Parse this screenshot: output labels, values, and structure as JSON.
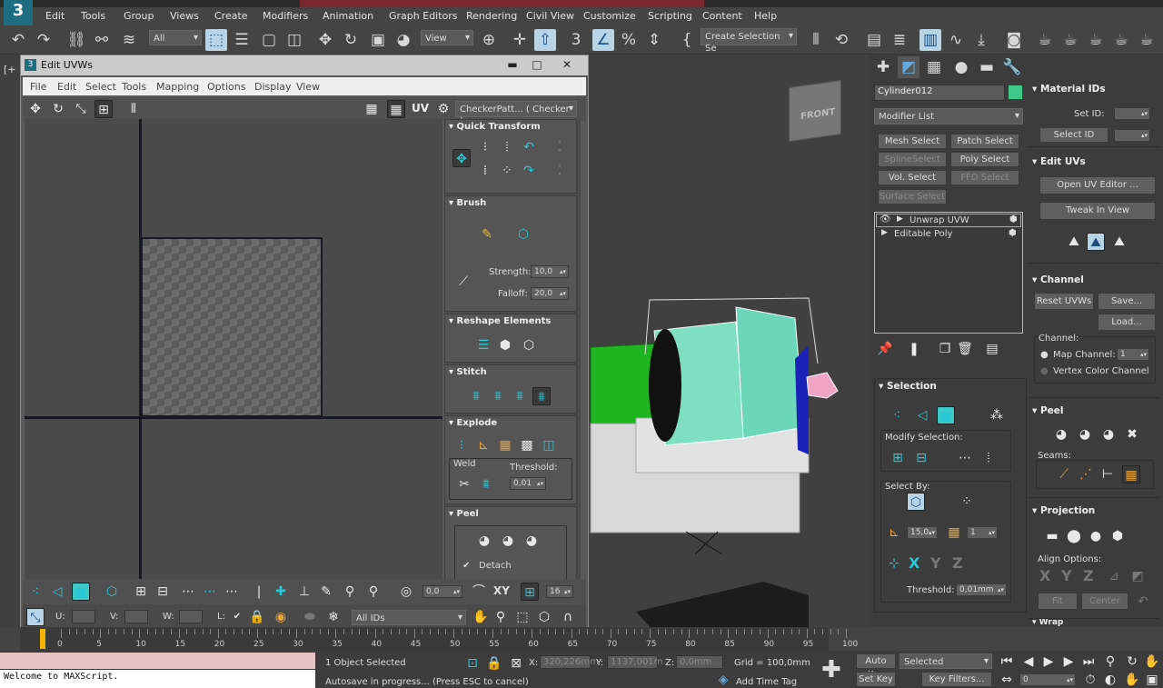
{
  "menus": [
    "Edit",
    "Tools",
    "Group",
    "Views",
    "Create",
    "Modifiers",
    "Animation",
    "Graph Editors",
    "Rendering",
    "Civil View",
    "Customize",
    "Scripting",
    "Content",
    "Help"
  ],
  "toolbar": {
    "filter": "All",
    "view": "View",
    "create_selection": "Create Selection Se"
  },
  "viewport": {
    "label": "[+",
    "viewcube": "FRONT"
  },
  "uv_window": {
    "title": "Edit UVWs",
    "title_icon": "3",
    "menu": [
      "File",
      "Edit",
      "Select",
      "Tools",
      "Mapping",
      "Options",
      "Display",
      "View"
    ],
    "uv_label": "UV",
    "texture": "CheckerPatt... ( Checker )",
    "rollouts": {
      "quick_transform": "Quick Transform",
      "brush": {
        "title": "Brush",
        "strength_label": "Strength:",
        "strength": "10,0",
        "falloff_label": "Falloff:",
        "falloff": "20,0"
      },
      "reshape": "Reshape Elements",
      "stitch": "Stitch",
      "explode": {
        "title": "Explode",
        "weld": "Weld",
        "threshold_label": "Threshold:",
        "threshold": "0,01"
      },
      "peel": {
        "title": "Peel",
        "detach": "Detach"
      }
    },
    "bottom": {
      "rotate": "0,0",
      "xy": "XY",
      "grid": "16",
      "u": "U:",
      "v": "V:",
      "w": "W:",
      "l": "L:",
      "ids": "All IDs"
    }
  },
  "command_panel": {
    "object_name": "Cylinder012",
    "object_color": "#3ec98a",
    "modifier_list": "Modifier List",
    "buttons": [
      "Mesh Select",
      "Patch Select",
      "SplineSelect",
      "Poly Select",
      "Vol. Select",
      "FFD Select",
      "Surface Select"
    ],
    "stack": [
      "Unwrap UVW",
      "Editable Poly"
    ],
    "selection": {
      "title": "Selection",
      "modify": "Modify Selection:",
      "select_by": "Select By:",
      "angle": "15,0",
      "count": "1",
      "x": "X",
      "y": "Y",
      "z": "Z",
      "threshold_label": "Threshold:",
      "threshold": "0,01mm"
    },
    "material_ids": {
      "title": "Material IDs",
      "set_id": "Set ID:",
      "select_id": "Select ID"
    },
    "edit_uvs": {
      "title": "Edit UVs",
      "open": "Open UV Editor ...",
      "tweak": "Tweak In View"
    },
    "channel": {
      "title": "Channel",
      "reset": "Reset UVWs",
      "save": "Save...",
      "load": "Load...",
      "channel_label": "Channel:",
      "map_channel": "Map Channel:",
      "map_value": "1",
      "vertex_color": "Vertex Color Channel"
    },
    "peel": {
      "title": "Peel",
      "seams": "Seams:"
    },
    "projection": {
      "title": "Projection",
      "align": "Align Options:",
      "x": "X",
      "y": "Y",
      "z": "Z",
      "fit": "Fit",
      "center": "Center"
    },
    "wrap": "Wrap"
  },
  "timeline": {
    "ticks": [
      "0",
      "5",
      "10",
      "15",
      "20",
      "25",
      "30",
      "35",
      "40",
      "45",
      "50",
      "55",
      "60",
      "65",
      "70",
      "75",
      "80",
      "85",
      "90",
      "95",
      "100"
    ]
  },
  "status": {
    "maxscript": "Welcome to MAXScript.",
    "selected": "1 Object Selected",
    "autosave": "Autosave in progress... (Press ESC to cancel)",
    "x_label": "X:",
    "x": "320,226mm",
    "y_label": "Y:",
    "y": "1137,001m",
    "z_label": "Z:",
    "z": "0,0mm",
    "grid": "Grid = 100,0mm",
    "add_time_tag": "Add Time Tag",
    "auto_key": "Auto Key",
    "set_key": "Set Key",
    "key_mode": "Selected",
    "key_filters": "Key Filters...",
    "frame": "0"
  }
}
